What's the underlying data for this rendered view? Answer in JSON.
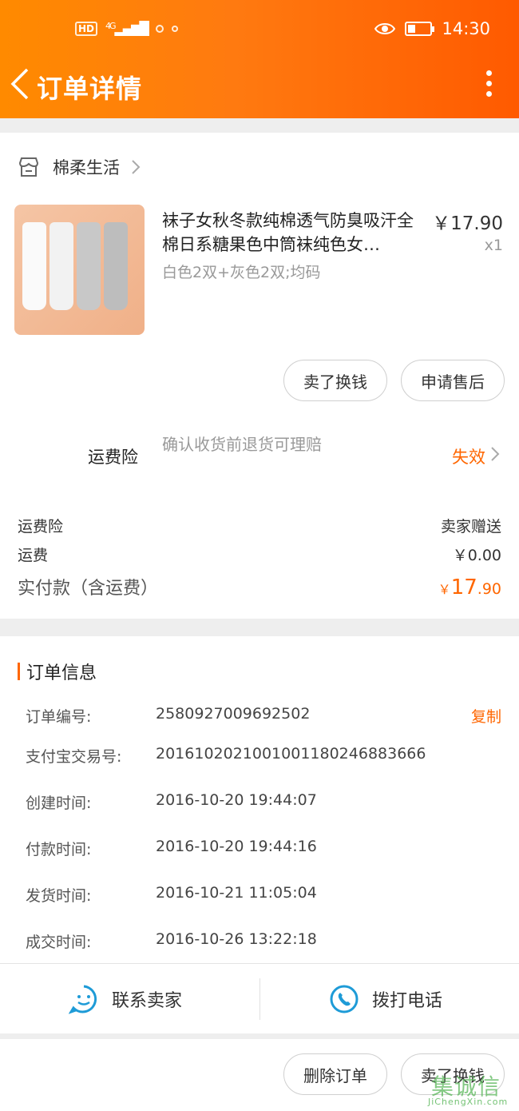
{
  "status_bar": {
    "net_chip": "HD",
    "net_type": "4G",
    "time": "14:30"
  },
  "nav": {
    "title": "订单详情"
  },
  "shop": {
    "name": "棉柔生活"
  },
  "product": {
    "title": "袜子女秋冬款纯棉透气防臭吸汗全棉日系糖果色中筒袜纯色女…",
    "price": "￥17.90",
    "qty": "x1",
    "spec": "白色2双+灰色2双;均码",
    "actions": [
      "卖了换钱",
      "申请售后"
    ]
  },
  "shipping_insurance": {
    "label": "运费险",
    "desc": "确认收货前退货可理赔",
    "status": "失效"
  },
  "costs": {
    "rows": [
      {
        "label": "运费险",
        "value": "卖家赠送"
      },
      {
        "label": "运费",
        "value": "￥0.00"
      }
    ],
    "total_label": "实付款（含运费）",
    "total_currency": "￥",
    "total_int": "17",
    "total_dec": ".90"
  },
  "order_info": {
    "title": "订单信息",
    "copy_label": "复制",
    "rows": [
      {
        "label": "订单编号:",
        "value": "2580927009692502"
      },
      {
        "label": "支付宝交易号:",
        "value": "2016102021001001180246883666"
      },
      {
        "label": "创建时间:",
        "value": "2016-10-20 19:44:07"
      },
      {
        "label": "付款时间:",
        "value": "2016-10-20 19:44:16"
      },
      {
        "label": "发货时间:",
        "value": "2016-10-21 11:05:04"
      },
      {
        "label": "成交时间:",
        "value": "2016-10-26 13:22:18"
      }
    ]
  },
  "contact": {
    "seller": "联系卖家",
    "phone": "拨打电话"
  },
  "footer": {
    "actions": [
      "删除订单",
      "卖了换钱"
    ]
  },
  "watermark": {
    "text": "集诚信",
    "sub": "JiChengXin.com"
  },
  "colors": {
    "accent": "#ff6600",
    "header_start": "#ff8a00",
    "header_end": "#ff5a00",
    "contact_icon": "#1e9bd7"
  }
}
